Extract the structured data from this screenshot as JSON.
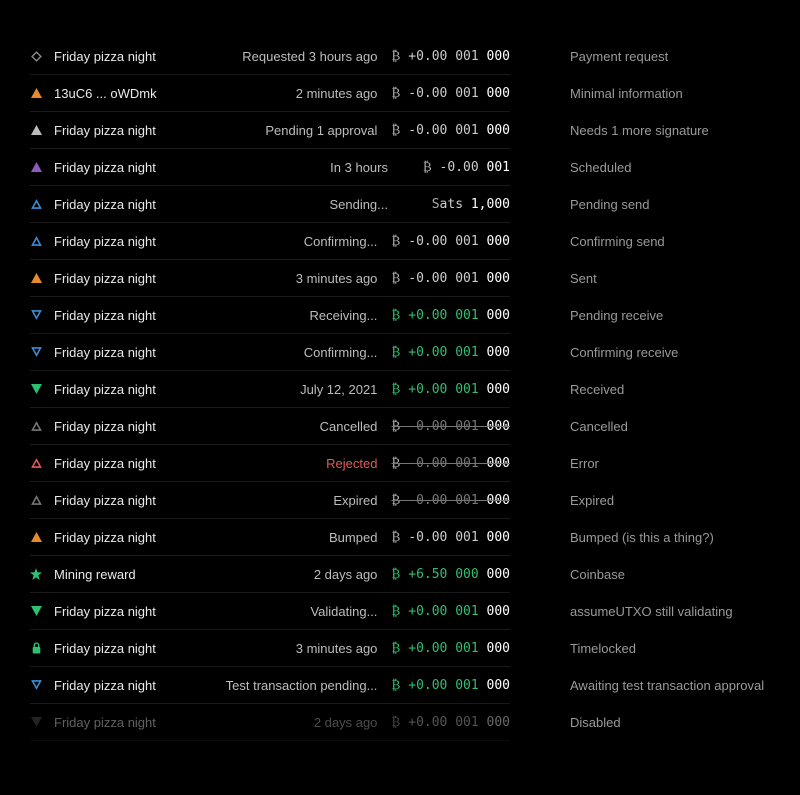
{
  "rows": [
    {
      "icon": "diamond-outline",
      "iconColor": "#888",
      "title": "Friday pizza night",
      "status": "Requested 3 hours ago",
      "amount": "₿ +0.00 001 000",
      "amountClass": "neg",
      "side": "Payment request"
    },
    {
      "icon": "triangle-up",
      "iconColor": "#e68a2e",
      "title": "13uC6 ... oWDmk",
      "status": "2 minutes ago",
      "amount": "₿ -0.00 001 000",
      "amountClass": "neg",
      "side": "Minimal information"
    },
    {
      "icon": "triangle-up",
      "iconColor": "#bbb",
      "title": "Friday pizza night",
      "status": "Pending 1 approval",
      "amount": "₿ -0.00 001 000",
      "amountClass": "neg",
      "side": "Needs 1 more signature"
    },
    {
      "icon": "triangle-up",
      "iconColor": "#8a5cbf",
      "title": "Friday pizza night",
      "status": "In 3 hours",
      "amount": "₿ -0.00 001",
      "amountClass": "neg",
      "side": "Scheduled"
    },
    {
      "icon": "triangle-up-outline",
      "iconColor": "#3a8fd8",
      "title": "Friday pizza night",
      "status": "Sending...",
      "amount": "Sats 1,000",
      "amountClass": "neg",
      "side": "Pending send"
    },
    {
      "icon": "triangle-up-outline",
      "iconColor": "#3a8fd8",
      "title": "Friday pizza night",
      "status": "Confirming...",
      "amount": "₿ -0.00 001 000",
      "amountClass": "neg",
      "side": "Confirming send"
    },
    {
      "icon": "triangle-up",
      "iconColor": "#e68a2e",
      "title": "Friday pizza night",
      "status": "3 minutes ago",
      "amount": "₿ -0.00 001 000",
      "amountClass": "neg",
      "side": "Sent"
    },
    {
      "icon": "triangle-down-outline",
      "iconColor": "#3a8fd8",
      "title": "Friday pizza night",
      "status": "Receiving...",
      "amount": "₿ +0.00 001 000",
      "amountClass": "pos",
      "side": "Pending receive"
    },
    {
      "icon": "triangle-down-outline",
      "iconColor": "#3a8fd8",
      "title": "Friday pizza night",
      "status": "Confirming...",
      "amount": "₿ +0.00 001 000",
      "amountClass": "pos",
      "side": "Confirming receive"
    },
    {
      "icon": "triangle-down",
      "iconColor": "#2fbf71",
      "title": "Friday pizza night",
      "status": "July 12, 2021",
      "amount": "₿ +0.00 001 000",
      "amountClass": "pos",
      "side": "Received"
    },
    {
      "icon": "triangle-up-outline",
      "iconColor": "#777",
      "title": "Friday pizza night",
      "status": "Cancelled",
      "amount": "₿ -0.00 001 000",
      "amountClass": "strike",
      "side": "Cancelled"
    },
    {
      "icon": "triangle-up-outline",
      "iconColor": "#e05a5a",
      "title": "Friday pizza night",
      "status": "Rejected",
      "statusClass": "error",
      "amount": "₿ -0.00 001 000",
      "amountClass": "strike",
      "side": "Error"
    },
    {
      "icon": "triangle-up-outline",
      "iconColor": "#777",
      "title": "Friday pizza night",
      "status": "Expired",
      "amount": "₿ -0.00 001 000",
      "amountClass": "strike",
      "side": "Expired"
    },
    {
      "icon": "triangle-up",
      "iconColor": "#e68a2e",
      "title": "Friday pizza night",
      "status": "Bumped",
      "amount": "₿ -0.00 001 000",
      "amountClass": "neg",
      "side": "Bumped (is this a thing?)"
    },
    {
      "icon": "star",
      "iconColor": "#2fbf71",
      "title": "Mining reward",
      "status": "2 days ago",
      "amount": "₿ +6.50 000 000",
      "amountClass": "pos",
      "side": "Coinbase"
    },
    {
      "icon": "triangle-down",
      "iconColor": "#2fbf71",
      "title": "Friday pizza night",
      "status": "Validating...",
      "amount": "₿ +0.00 001 000",
      "amountClass": "pos",
      "side": "assumeUTXO still validating"
    },
    {
      "icon": "lock",
      "iconColor": "#2fbf71",
      "title": "Friday pizza night",
      "status": "3 minutes ago",
      "amount": "₿ +0.00 001 000",
      "amountClass": "pos",
      "side": "Timelocked"
    },
    {
      "icon": "triangle-down-outline",
      "iconColor": "#3a8fd8",
      "title": "Friday pizza night",
      "status": "Test transaction pending...",
      "amount": "₿ +0.00 001 000",
      "amountClass": "pos",
      "side": "Awaiting test transaction approval"
    },
    {
      "icon": "triangle-down",
      "iconColor": "#555",
      "title": "Friday pizza night",
      "status": "2 days ago",
      "amount": "₿ +0.00 001 000",
      "amountClass": "neg",
      "rowClass": "disabled",
      "side": "Disabled"
    }
  ]
}
